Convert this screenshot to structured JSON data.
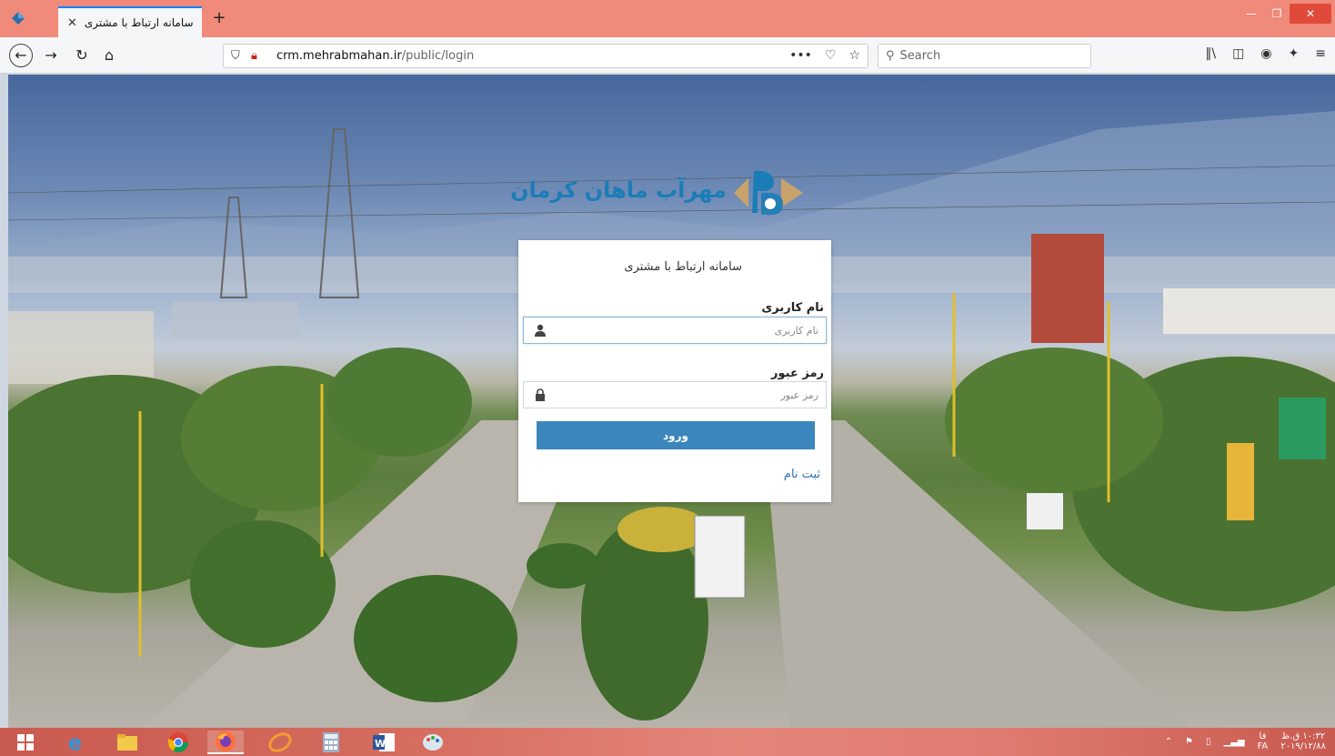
{
  "browser": {
    "tab_title": "سامانه ارتباط با مشتری",
    "tab_close": "✕",
    "new_tab": "+",
    "url_host": "crm.mehrabmahan.ir",
    "url_path": "/public/login",
    "search_placeholder": "Search",
    "window_controls": {
      "minimize": "—",
      "maximize": "❐",
      "close": "✕"
    }
  },
  "logo": {
    "text": "مهرآب ماهان کرمان",
    "brand_color": "#1b7db7",
    "accent_color": "#c9a36b"
  },
  "login": {
    "title": "سامانه ارتباط با مشتری",
    "username_label": "نام کاربری",
    "username_placeholder": "نام کاربری",
    "password_label": "رمز عبور",
    "password_placeholder": "رمز عبور",
    "submit_label": "ورود",
    "register_link": "ثبت نام",
    "button_color": "#3a86bd"
  },
  "taskbar": {
    "apps": [
      "windows-start",
      "internet-explorer",
      "file-explorer",
      "chrome",
      "firefox",
      "edit-app",
      "calculator",
      "word",
      "paint"
    ],
    "clock_time": "۱۰:۳۲ ق.ظ",
    "clock_date": "۲۰۱۹/۱۲/۸۸",
    "lang_top": "فا",
    "lang_bottom": "FA"
  }
}
